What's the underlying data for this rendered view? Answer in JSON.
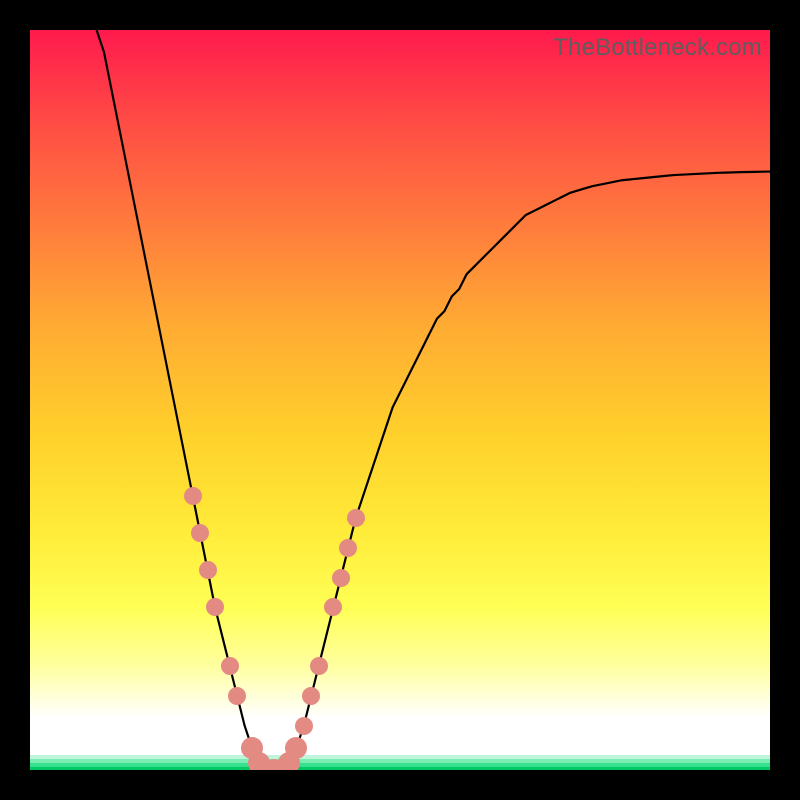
{
  "watermark": "TheBottleneck.com",
  "colors": {
    "frame": "#000000",
    "watermark": "#5e5e5e",
    "curve": "#000000",
    "bead": "#e38a82",
    "gradient_top": "#ff1a4d",
    "gradient_upper_mid": "#ff7a3d",
    "gradient_mid": "#ffd12b",
    "gradient_lower_mid": "#ffff55",
    "gradient_pale": "#ffffb0",
    "green_dark": "#00c864",
    "green_mid": "#2de88a",
    "green_light": "#9af2c4"
  },
  "chart_data": {
    "type": "line",
    "title": "",
    "xlabel": "",
    "ylabel": "",
    "xlim": [
      0,
      100
    ],
    "ylim": [
      0,
      100
    ],
    "x": [
      0,
      1,
      2,
      3,
      4,
      5,
      6,
      7,
      8,
      9,
      10,
      11,
      12,
      13,
      14,
      15,
      16,
      17,
      18,
      19,
      20,
      21,
      22,
      23,
      24,
      25,
      26,
      27,
      28,
      29,
      30,
      31,
      32,
      33,
      34,
      35,
      36,
      37,
      38,
      39,
      40,
      41,
      42,
      43,
      44,
      45,
      46,
      47,
      48,
      49,
      50,
      51,
      52,
      53,
      54,
      55,
      56,
      57,
      58,
      59,
      60,
      61,
      62,
      63,
      64,
      65,
      66,
      67,
      68,
      69,
      70,
      71,
      72,
      73,
      74,
      75,
      76,
      77,
      78,
      79,
      80,
      81,
      82,
      83,
      84,
      85,
      86,
      87,
      88,
      89,
      90,
      91,
      92,
      93,
      94,
      95,
      96,
      97,
      98,
      99,
      100
    ],
    "y_bottleneck_pct": [
      100,
      100,
      100,
      100,
      100,
      100,
      100,
      100,
      100,
      100,
      97,
      92,
      87,
      82,
      77,
      72,
      67,
      62,
      57,
      52,
      47,
      42,
      37,
      32,
      27,
      22,
      18,
      14,
      10,
      6,
      3,
      1,
      0,
      0,
      0,
      1,
      3,
      6,
      10,
      14,
      18,
      22,
      26,
      30,
      34,
      37,
      40,
      43,
      46,
      49,
      51,
      53,
      55,
      57,
      59,
      61,
      62,
      64,
      65,
      67,
      68,
      69,
      70,
      71,
      72,
      73,
      74,
      75,
      75.5,
      76,
      76.5,
      77,
      77.5,
      78,
      78.3,
      78.6,
      78.9,
      79.1,
      79.3,
      79.5,
      79.7,
      79.8,
      79.9,
      80,
      80.1,
      80.2,
      80.3,
      80.4,
      80.45,
      80.5,
      80.55,
      80.6,
      80.65,
      80.7,
      80.73,
      80.76,
      80.79,
      80.81,
      80.83,
      80.85,
      80.87
    ],
    "trough_x_range": [
      31,
      35
    ],
    "bead_markers_x": [
      22,
      23,
      24,
      25,
      27,
      28,
      30,
      31,
      32,
      33,
      34,
      35,
      36,
      37,
      38,
      39,
      41,
      42,
      43,
      44
    ]
  }
}
